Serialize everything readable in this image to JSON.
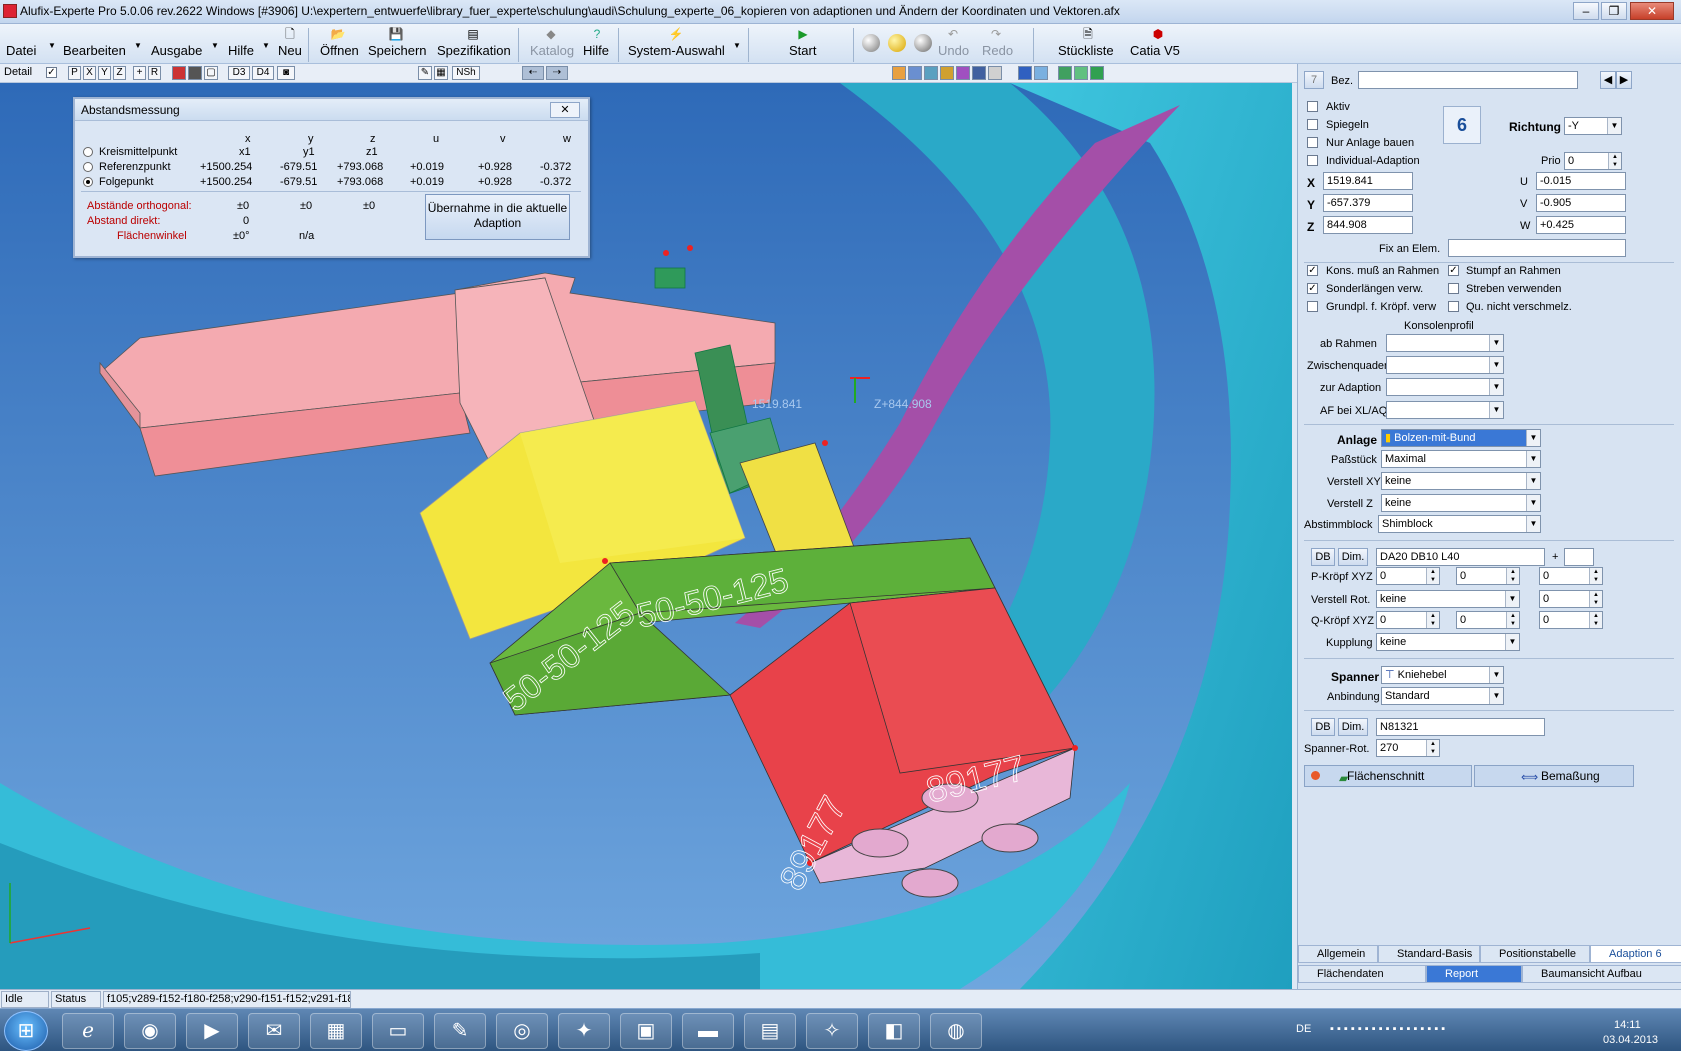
{
  "window": {
    "title": "Alufix-Experte Pro 5.0.06 rev.2622 Windows [#3906] U:\\expertern_entwuerfe\\library_fuer_experte\\schulung\\audi\\Schulung_experte_06_kopieren von adaptionen und Ändern der Koordinaten und Vektoren.afx"
  },
  "menu": {
    "datei": "Datei",
    "bearbeiten": "Bearbeiten",
    "ausgabe": "Ausgabe",
    "hilfe1": "Hilfe",
    "neu": "Neu",
    "oeffnen": "Öffnen",
    "speichern": "Speichern",
    "spezifikation": "Spezifikation",
    "katalog": "Katalog",
    "hilfe2": "Hilfe",
    "system": "System-Auswahl",
    "start": "Start",
    "undo": "Undo",
    "redo": "Redo",
    "stueckliste": "Stückliste",
    "catia": "Catia V5"
  },
  "toolbar2": {
    "detail": "Detail",
    "negativ": "negativ",
    "btns": [
      "P",
      "X",
      "Y",
      "Z",
      "+",
      "R"
    ],
    "d3": "D3",
    "d4": "D4",
    "nsh": "NSh"
  },
  "dialog": {
    "title": "Abstandsmessung",
    "headers": [
      "x",
      "y",
      "z",
      "u",
      "v",
      "w"
    ],
    "subheaders": [
      "x1",
      "y1",
      "z1"
    ],
    "rows": [
      {
        "label": "Kreismittelpunkt",
        "vals": [
          "",
          "",
          "",
          "",
          "",
          ""
        ]
      },
      {
        "label": "Referenzpunkt",
        "vals": [
          "+1500.254",
          "-679.51",
          "+793.068",
          "+0.019",
          "+0.928",
          "-0.372"
        ]
      },
      {
        "label": "Folgepunkt",
        "vals": [
          "+1500.254",
          "-679.51",
          "+793.068",
          "+0.019",
          "+0.928",
          "-0.372"
        ]
      }
    ],
    "ortho_label": "Abstände orthogonal:",
    "ortho": [
      "±0",
      "±0",
      "±0"
    ],
    "direkt_label": "Abstand      direkt:",
    "direkt": "0",
    "winkel_label": "Flächenwinkel",
    "winkel": "±0°",
    "winkel2": "n/a",
    "button": "Übernahme in die aktuelle Adaption"
  },
  "viewport": {
    "coord_label": "1519.841",
    "coord_label2": "Z+844.908",
    "part_text1": "50-50-125",
    "part_text2": "50-50-125",
    "part_text3": "89177",
    "part_text4": "89177"
  },
  "panel": {
    "num": "7",
    "bez": "Bez.",
    "aktiv": "Aktiv",
    "spiegeln": "Spiegeln",
    "nur_anlage": "Nur Anlage bauen",
    "individual": "Individual-Adaption",
    "badge": "6",
    "richtung": "Richtung",
    "richtung_val": "-Y",
    "prio": "Prio",
    "prio_val": "0",
    "x": "1519.841",
    "y": "-657.379",
    "z": "844.908",
    "u": "-0.015",
    "v": "-0.905",
    "w": "+0.425",
    "fix": "Fix an Elem.",
    "kons": "Kons. muß an Rahmen",
    "stumpf": "Stumpf an Rahmen",
    "sonder": "Sonderlängen verw.",
    "streben": "Streben verwenden",
    "grundpl": "Grundpl. f. Kröpf. verw",
    "qu": "Qu. nicht verschmelz.",
    "konsolenprofil": "Konsolenprofil",
    "ab_rahmen": "ab Rahmen",
    "zwischenquader": "Zwischenquader",
    "zur_adaption": "zur Adaption",
    "af": "AF bei XL/AQ",
    "anlage": "Anlage",
    "anlage_val": "Bolzen-mit-Bund",
    "passstueck": "Paßstück",
    "passstueck_val": "Maximal",
    "verstell_xy": "Verstell XY",
    "verstell_xy_val": "keine",
    "verstell_z": "Verstell  Z",
    "verstell_z_val": "keine",
    "abstimm": "Abstimmblock",
    "abstimm_val": "Shimblock",
    "db": "DB",
    "dim": "Dim.",
    "da": "DA20 DB10 L40",
    "plus": "+",
    "pkropf": "P-Kröpf XYZ",
    "pk": [
      "0",
      "0",
      "0"
    ],
    "verstell_rot": "Verstell Rot.",
    "verstell_rot_val": "keine",
    "vr2": "0",
    "qkropf": "Q-Kröpf XYZ",
    "qk": [
      "0",
      "0",
      "0"
    ],
    "kupplung": "Kupplung",
    "kupplung_val": "keine",
    "spanner": "Spanner",
    "spanner_val": "Kniehebel",
    "anbindung": "Anbindung",
    "anbindung_val": "Standard",
    "n8": "N81321",
    "spanner_rot": "Spanner-Rot.",
    "spanner_rot_val": "270",
    "flaechenschnitt": "Flächenschnitt",
    "bemassung": "Bemaßung",
    "tabs1": [
      "Allgemein",
      "Standard-Basis",
      "Positionstabelle",
      "Adaption 6"
    ],
    "tabs2": [
      "Flächendaten",
      "Report",
      "Baumansicht Aufbau"
    ]
  },
  "status": {
    "idle": "Idle",
    "status": "Status",
    "info": "f105;v289-f152-f180-f258;v290-f151-f152;v291-f180"
  },
  "tray": {
    "lang": "DE",
    "time": "14:11",
    "date": "03.04.2013"
  }
}
